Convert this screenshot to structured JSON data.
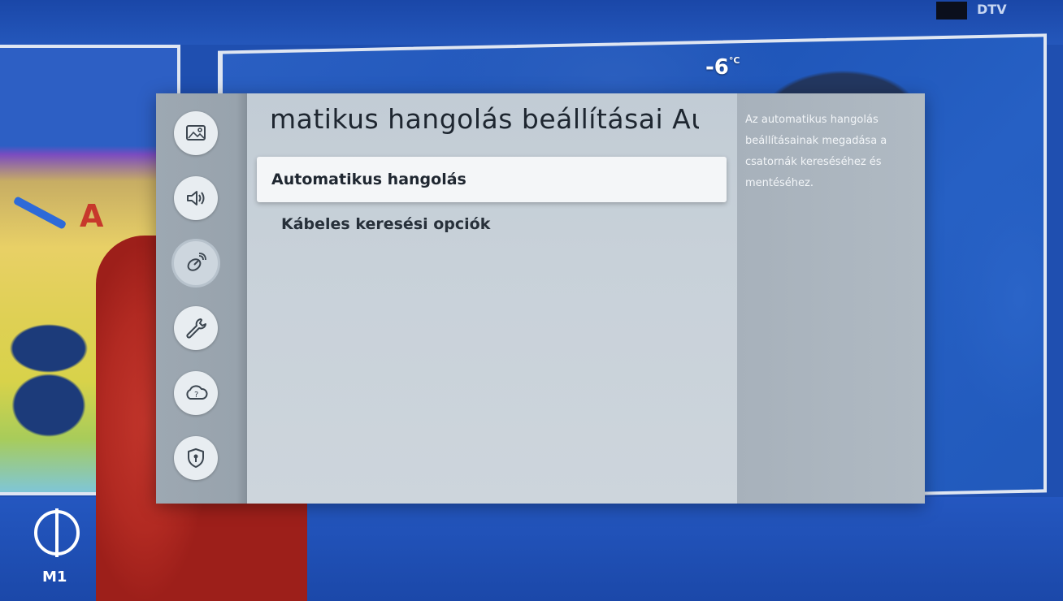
{
  "broadcast": {
    "temperature": "-6",
    "temperature_unit": "°C",
    "channel_logo": "M1",
    "corner_text": "DTV"
  },
  "rail_icons": [
    {
      "name": "picture-icon",
      "active": false
    },
    {
      "name": "sound-icon",
      "active": false
    },
    {
      "name": "broadcasting-icon",
      "active": true
    },
    {
      "name": "general-icon",
      "active": false
    },
    {
      "name": "support-icon",
      "active": false
    },
    {
      "name": "privacy-icon",
      "active": false
    }
  ],
  "main": {
    "title": "matikus hangolás beállításai  Aut",
    "items": [
      {
        "label": "Automatikus hangolás",
        "selected": true
      },
      {
        "label": "Kábeles keresési opciók",
        "selected": false
      }
    ]
  },
  "help": {
    "text": "Az automatikus hangolás beállításainak megadása a csatornák kereséséhez és mentéséhez."
  },
  "colors": {
    "accent_selected": "#f4f6f8",
    "panel": "#c8d1d9",
    "rail": "#9da8b2"
  }
}
